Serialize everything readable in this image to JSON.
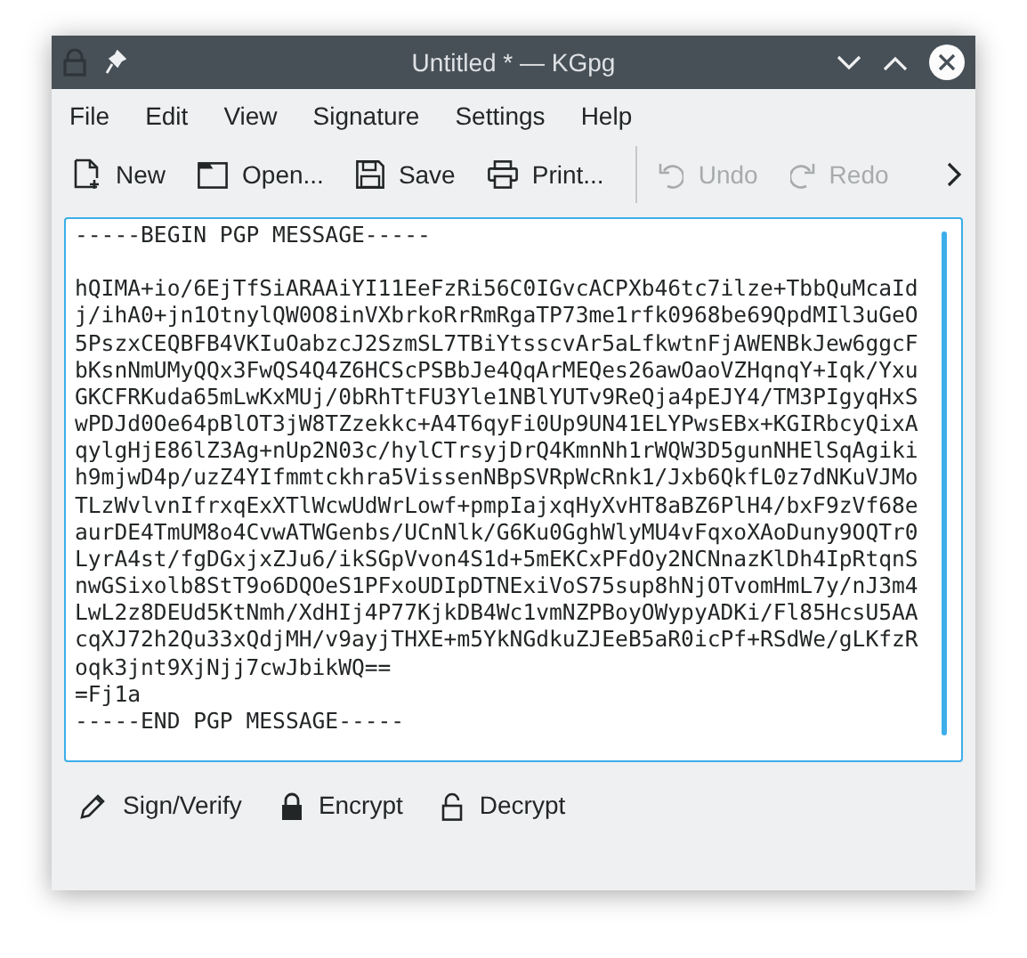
{
  "window": {
    "title": "Untitled * — KGpg"
  },
  "menu": [
    "File",
    "Edit",
    "View",
    "Signature",
    "Settings",
    "Help"
  ],
  "toolbar": [
    {
      "label": "New",
      "disabled": false
    },
    {
      "label": "Open...",
      "disabled": false
    },
    {
      "label": "Save",
      "disabled": false
    },
    {
      "label": "Print...",
      "disabled": false
    },
    {
      "label": "Undo",
      "disabled": true
    },
    {
      "label": "Redo",
      "disabled": true
    }
  ],
  "editor": {
    "value": "-----BEGIN PGP MESSAGE-----\n\nhQIMA+io/6EjTfSiARAAiYI11EeFzRi56C0IGvcACPXb46tc7ilze+TbbQuMcaId\nj/ihA0+jn1OtnylQW0O8inVXbrkoRrRmRgaTP73me1rfk0968be69QpdMIl3uGeO\n5PszxCEQBFB4VKIuOabzcJ2SzmSL7TBiYtsscvAr5aLfkwtnFjAWENBkJew6ggcF\nbKsnNmUMyQQx3FwQS4Q4Z6HCScPSBbJe4QqArMEQes26awOaoVZHqnqY+Iqk/Yxu\nGKCFRKuda65mLwKxMUj/0bRhTtFU3Yle1NBlYUTv9ReQja4pEJY4/TM3PIgyqHxS\nwPDJd0Oe64pBlOT3jW8TZzekkc+A4T6qyFi0Up9UN41ELYPwsEBx+KGIRbcyQixA\nqylgHjE86lZ3Ag+nUp2N03c/hylCTrsyjDrQ4KmnNh1rWQW3D5gunNHElSqAgiki\nh9mjwD4p/uzZ4YIfmmtckhra5VissenNBpSVRpWcRnk1/Jxb6QkfL0z7dNKuVJMo\nTLzWvlvnIfrxqExXTlWcwUdWrLowf+pmpIajxqHyXvHT8aBZ6PlH4/bxF9zVf68e\naurDE4TmUM8o4CvwATWGenbs/UCnNlk/G6Ku0GghWlyMU4vFqxoXAoDuny9OQTr0\nLyrA4st/fgDGxjxZJu6/ikSGpVvon4S1d+5mEKCxPFdOy2NCNnazKlDh4IpRtqnS\nnwGSixolb8StT9o6DQOeS1PFxoUDIpDTNExiVoS75sup8hNjOTvomHmL7y/nJ3m4\nLwL2z8DEUd5KtNmh/XdHIj4P77KjkDB4Wc1vmNZPBoyOWypyADKi/Fl85HcsU5AA\ncqXJ72h2Qu33xQdjMH/v9ayjTHXE+m5YkNGdkuZJEeB5aR0icPf+RSdWe/gLKfzR\noqk3jnt9XjNjj7cwJbikWQ==\n=Fj1a\n-----END PGP MESSAGE-----"
  },
  "actions": [
    "Sign/Verify",
    "Encrypt",
    "Decrypt"
  ]
}
